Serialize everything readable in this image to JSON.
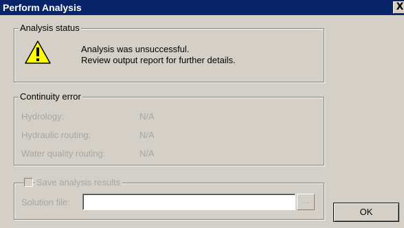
{
  "window": {
    "title": "Perform Analysis",
    "close_label": "X"
  },
  "status": {
    "legend": "Analysis status",
    "icon": "warning-icon",
    "line1": "Analysis was unsuccessful.",
    "line2": "Review output report for further details."
  },
  "continuity": {
    "legend": "Continuity error",
    "rows": [
      {
        "label": "Hydrology:",
        "value": "N/A"
      },
      {
        "label": "Hydraulic routing:",
        "value": "N/A"
      },
      {
        "label": "Water quality routing:",
        "value": "N/A"
      }
    ]
  },
  "save": {
    "checkbox_label": "Save analysis results",
    "checked": false,
    "solution_label": "Solution file:",
    "solution_value": "",
    "browse_label": "..."
  },
  "buttons": {
    "ok": "OK"
  },
  "colors": {
    "title_bar": "#0a246a",
    "dialog_bg": "#d4d0c8",
    "disabled_text": "#a6a6a6",
    "warning_yellow": "#ffff00"
  }
}
